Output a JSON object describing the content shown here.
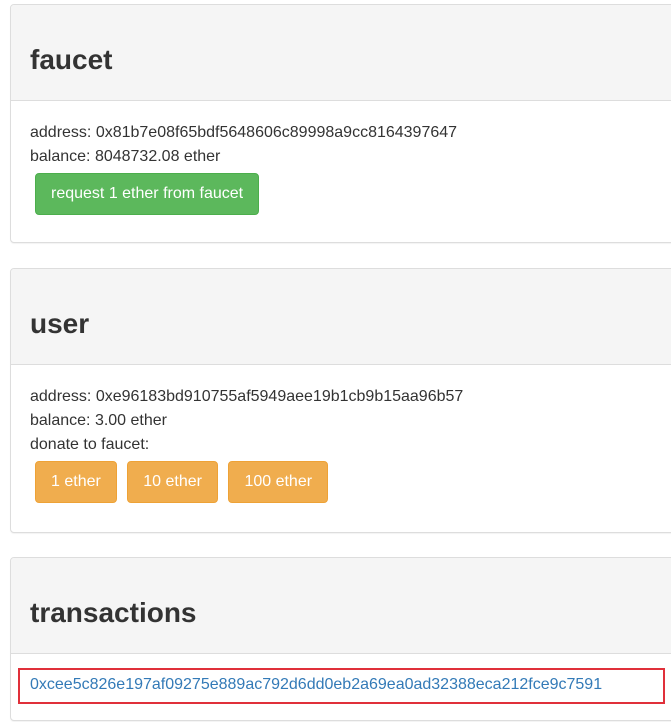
{
  "faucet": {
    "title": "faucet",
    "address_line": "address: 0x81b7e08f65bdf5648606c89998a9cc8164397647",
    "balance_line": "balance: 8048732.08 ether",
    "request_button": "request 1 ether from faucet"
  },
  "user": {
    "title": "user",
    "address_line": "address: 0xe96183bd910755af5949aee19b1cb9b15aa96b57",
    "balance_line": "balance: 3.00 ether",
    "donate_label": "donate to faucet:",
    "donate_buttons": [
      "1 ether",
      "10 ether",
      "100 ether"
    ]
  },
  "transactions": {
    "title": "transactions",
    "items": [
      "0xcee5c826e197af09275e889ac792d6dd0eb2a69ea0ad32388eca212fce9c7591"
    ]
  },
  "colors": {
    "success": "#5cb85c",
    "warning": "#f0ad4e",
    "link": "#337ab7",
    "highlight": "#e0303a"
  }
}
